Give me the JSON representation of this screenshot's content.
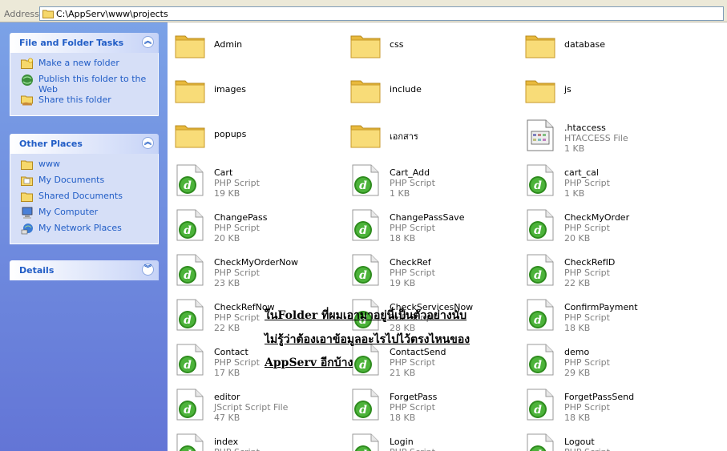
{
  "address": {
    "label": "Address",
    "path": "C:\\AppServ\\www\\projects"
  },
  "taskpane": {
    "file_tasks": {
      "title": "File and Folder Tasks",
      "items": [
        {
          "label": "Make a new folder",
          "icon": "new-folder-icon"
        },
        {
          "label": "Publish this folder to the Web",
          "icon": "publish-web-icon"
        },
        {
          "label": "Share this folder",
          "icon": "share-folder-icon"
        }
      ]
    },
    "other_places": {
      "title": "Other Places",
      "items": [
        {
          "label": "www",
          "icon": "folder-icon"
        },
        {
          "label": "My Documents",
          "icon": "my-documents-icon"
        },
        {
          "label": "Shared Documents",
          "icon": "shared-documents-icon"
        },
        {
          "label": "My Computer",
          "icon": "my-computer-icon"
        },
        {
          "label": "My Network Places",
          "icon": "network-places-icon"
        }
      ]
    },
    "details": {
      "title": "Details"
    }
  },
  "files": [
    {
      "name": "Admin",
      "kind": "folder"
    },
    {
      "name": "css",
      "kind": "folder"
    },
    {
      "name": "database",
      "kind": "folder"
    },
    {
      "name": "images",
      "kind": "folder"
    },
    {
      "name": "include",
      "kind": "folder"
    },
    {
      "name": "js",
      "kind": "folder"
    },
    {
      "name": "popups",
      "kind": "folder"
    },
    {
      "name": "เอกสาร",
      "kind": "folder"
    },
    {
      "name": ".htaccess",
      "kind": "htaccess",
      "type": "HTACCESS File",
      "size": "1 KB"
    },
    {
      "name": "Cart",
      "kind": "php",
      "type": "PHP Script",
      "size": "19 KB"
    },
    {
      "name": "Cart_Add",
      "kind": "php",
      "type": "PHP Script",
      "size": "1 KB"
    },
    {
      "name": "cart_cal",
      "kind": "php",
      "type": "PHP Script",
      "size": "1 KB"
    },
    {
      "name": "ChangePass",
      "kind": "php",
      "type": "PHP Script",
      "size": "20 KB"
    },
    {
      "name": "ChangePassSave",
      "kind": "php",
      "type": "PHP Script",
      "size": "18 KB"
    },
    {
      "name": "CheckMyOrder",
      "kind": "php",
      "type": "PHP Script",
      "size": "20 KB"
    },
    {
      "name": "CheckMyOrderNow",
      "kind": "php",
      "type": "PHP Script",
      "size": "23 KB"
    },
    {
      "name": "CheckRef",
      "kind": "php",
      "type": "PHP Script",
      "size": "19 KB"
    },
    {
      "name": "CheckRefID",
      "kind": "php",
      "type": "PHP Script",
      "size": "22 KB"
    },
    {
      "name": "CheckRefNow",
      "kind": "php",
      "type": "PHP Script",
      "size": "22 KB"
    },
    {
      "name": "CheckServicesNow",
      "kind": "php",
      "type": "PHP Script",
      "size": "28 KB"
    },
    {
      "name": "ConfirmPayment",
      "kind": "php",
      "type": "PHP Script",
      "size": "18 KB"
    },
    {
      "name": "Contact",
      "kind": "php",
      "type": "PHP Script",
      "size": "17 KB"
    },
    {
      "name": "ContactSend",
      "kind": "php",
      "type": "PHP Script",
      "size": "21 KB"
    },
    {
      "name": "demo",
      "kind": "php",
      "type": "PHP Script",
      "size": "29 KB"
    },
    {
      "name": "editor",
      "kind": "php",
      "type": "JScript Script File",
      "size": "47 KB"
    },
    {
      "name": "ForgetPass",
      "kind": "php",
      "type": "PHP Script",
      "size": "18 KB"
    },
    {
      "name": "ForgetPassSend",
      "kind": "php",
      "type": "PHP Script",
      "size": "18 KB"
    },
    {
      "name": "index",
      "kind": "php",
      "type": "PHP Script",
      "size": ""
    },
    {
      "name": "Login",
      "kind": "php",
      "type": "PHP Script",
      "size": ""
    },
    {
      "name": "Logout",
      "kind": "php",
      "type": "PHP Script",
      "size": ""
    }
  ],
  "annotation": {
    "line1": "ในFolder ที่ผมเอามาอยู่นี่เป็นตัวอย่างนับ",
    "line2": "ไม่รู้ว่าต้องเอาข้อมูลอะไรไปไว้ตรงไหนของ",
    "line3": "AppServ อีกบ้าง"
  }
}
